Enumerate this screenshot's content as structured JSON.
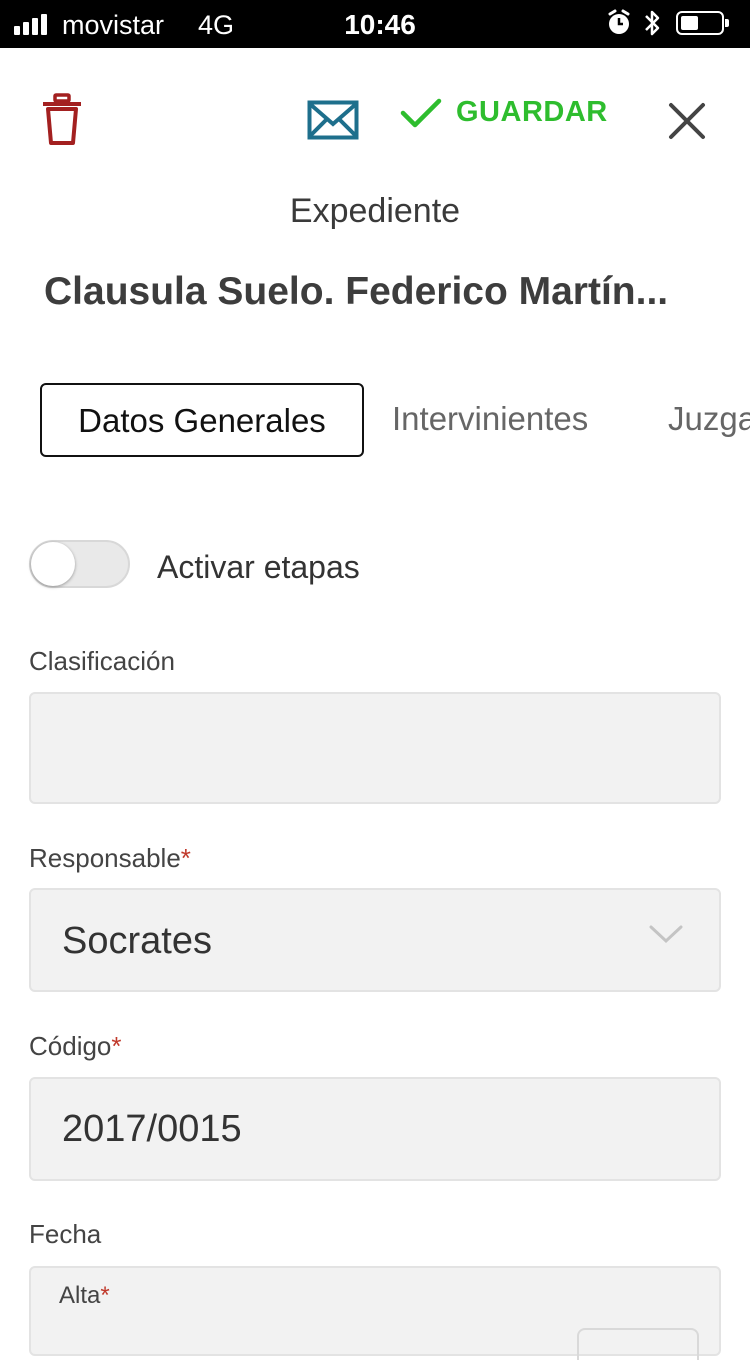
{
  "status_bar": {
    "carrier": "movistar",
    "network": "4G",
    "time": "10:46"
  },
  "toolbar": {
    "delete_icon": "trash-icon",
    "mail_icon": "envelope-icon",
    "save_label": "GUARDAR",
    "close_icon": "close-icon"
  },
  "header": {
    "subtitle": "Expediente",
    "title": "Clausula Suelo. Federico Martín..."
  },
  "tabs": [
    {
      "label": "Datos Generales",
      "active": true
    },
    {
      "label": "Intervinientes",
      "active": false
    },
    {
      "label": "Juzga",
      "active": false
    }
  ],
  "toggle": {
    "label": "Activar etapas",
    "on": false
  },
  "form": {
    "clasificacion": {
      "label": "Clasificación",
      "value": ""
    },
    "responsable": {
      "label": "Responsable",
      "required_mark": "*",
      "value": "Socrates"
    },
    "codigo": {
      "label": "Código",
      "required_mark": "*",
      "value": "2017/0015"
    },
    "fecha": {
      "label": "Fecha",
      "alta_label": "Alta",
      "required_mark": "*"
    }
  },
  "colors": {
    "save_green": "#2ebd2e",
    "trash_red": "#a32020",
    "mail_blue": "#1e6f8c",
    "required_red": "#c0392b"
  }
}
